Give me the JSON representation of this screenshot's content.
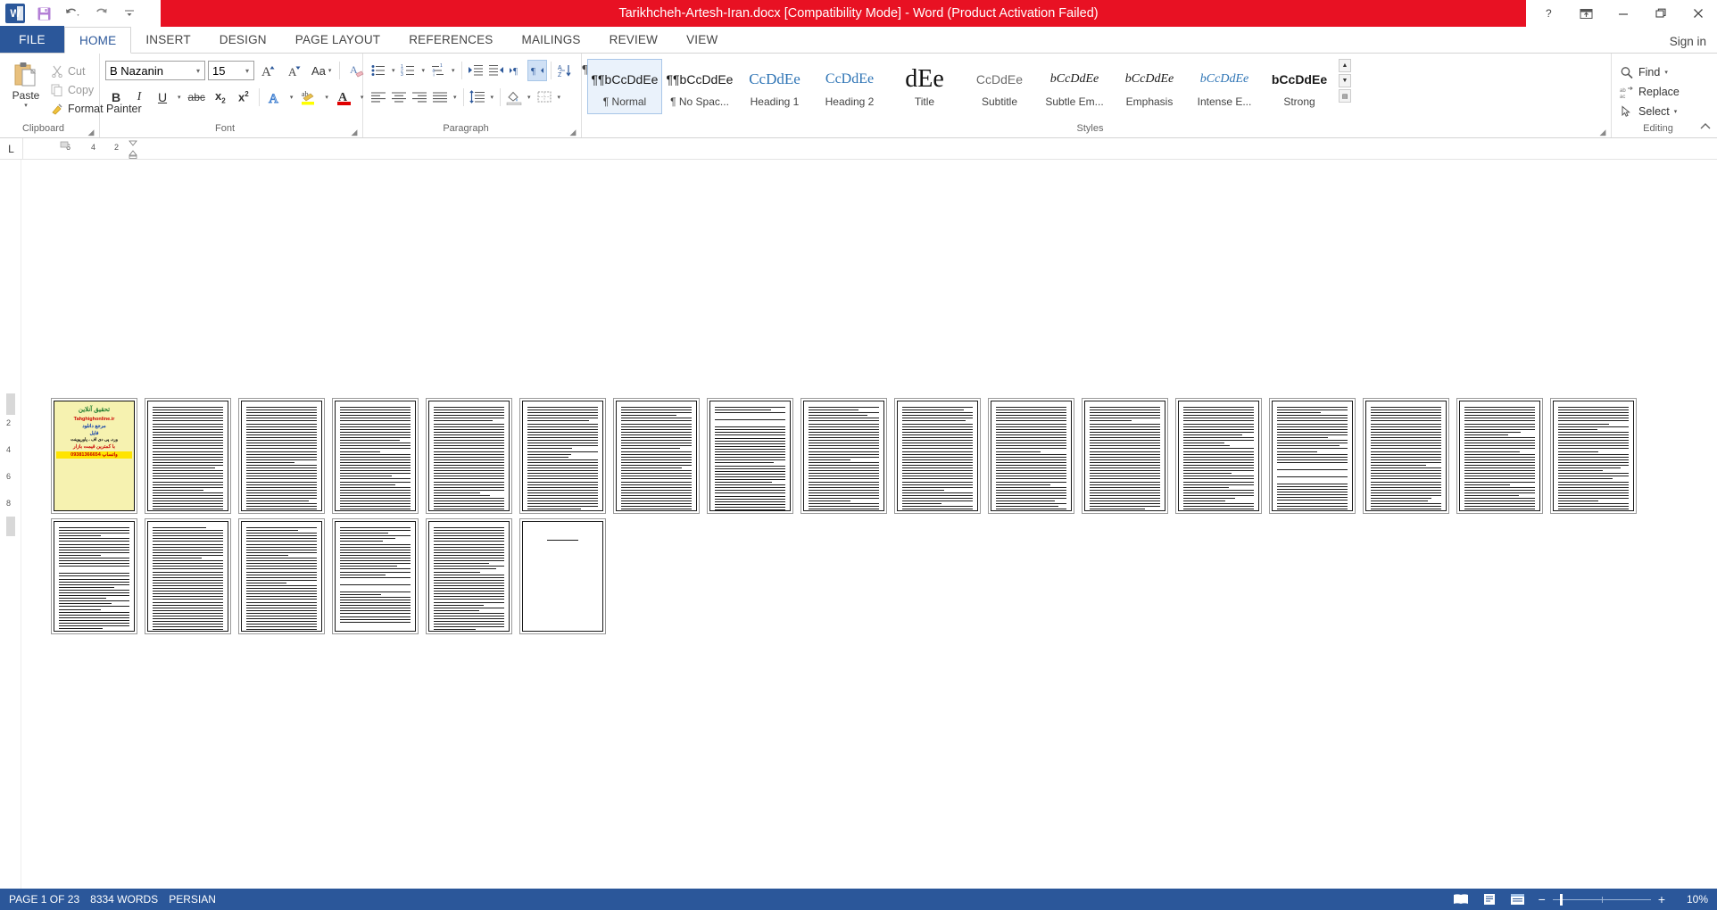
{
  "titlebar": {
    "document_title": "Tarikhcheh-Artesh-Iran.docx [Compatibility Mode]  -  Word (Product Activation Failed)",
    "quick_access": [
      {
        "name": "word-logo",
        "label": "W"
      },
      {
        "name": "save-icon",
        "label": "Save"
      },
      {
        "name": "undo-icon",
        "label": "Undo"
      },
      {
        "name": "redo-icon",
        "label": "Redo"
      },
      {
        "name": "customize-qat-icon",
        "label": "Customize Quick Access Toolbar"
      }
    ],
    "window_buttons": [
      {
        "name": "help-button",
        "glyph": "?"
      },
      {
        "name": "ribbon-display-options-button",
        "glyph": "⬆"
      },
      {
        "name": "minimize-button",
        "glyph": "—"
      },
      {
        "name": "restore-button",
        "glyph": "❐"
      },
      {
        "name": "close-button",
        "glyph": "✕"
      }
    ]
  },
  "tabs": {
    "file_label": "FILE",
    "items": [
      "HOME",
      "INSERT",
      "DESIGN",
      "PAGE LAYOUT",
      "REFERENCES",
      "MAILINGS",
      "REVIEW",
      "VIEW"
    ],
    "active": "HOME",
    "signin_label": "Sign in"
  },
  "ribbon": {
    "clipboard": {
      "group_label": "Clipboard",
      "paste_label": "Paste",
      "cut_label": "Cut",
      "copy_label": "Copy",
      "format_painter_label": "Format Painter"
    },
    "font": {
      "group_label": "Font",
      "font_family_value": "B Nazanin",
      "font_size_value": "15",
      "grow_font_label": "A",
      "shrink_font_label": "A",
      "change_case_label": "Aa",
      "clear_formatting_label": "Clear All Formatting",
      "bold_label": "B",
      "italic_label": "I",
      "underline_label": "U",
      "strikethrough_label": "abc",
      "subscript_label": "x₂",
      "superscript_label": "x²",
      "text_effects_label": "A",
      "highlight_label": "ab",
      "font_color_label": "A"
    },
    "paragraph": {
      "group_label": "Paragraph",
      "bullets_label": "Bullets",
      "numbering_label": "Numbering",
      "multilevel_label": "Multilevel List",
      "decrease_indent_label": "Decrease Indent",
      "increase_indent_label": "Increase Indent",
      "ltr_label": "▸¶",
      "rtl_label": "¶◂",
      "sort_label": "Sort",
      "show_marks_label": "¶",
      "align_left_label": "Align Left",
      "center_label": "Center",
      "align_right_label": "Align Right",
      "justify_label": "Justify",
      "line_spacing_label": "Line and Paragraph Spacing",
      "shading_label": "Shading",
      "borders_label": "Borders",
      "rtl_active": true
    },
    "styles": {
      "group_label": "Styles",
      "items": [
        {
          "name": "Normal",
          "preview": "¶bCcDdEe",
          "prefix": "¶",
          "color": "#1a1a1a",
          "font": "sans",
          "italic": false,
          "bold": false,
          "size": 14,
          "selected": true
        },
        {
          "name": "No Spac...",
          "preview": "¶bCcDdEe",
          "prefix": "¶",
          "color": "#1a1a1a",
          "font": "sans",
          "italic": false,
          "bold": false,
          "size": 14,
          "selected": false
        },
        {
          "name": "Heading 1",
          "preview": "CcDdEe",
          "prefix": "",
          "color": "#2e74b5",
          "font": "serif",
          "italic": false,
          "bold": false,
          "size": 17,
          "selected": false
        },
        {
          "name": "Heading 2",
          "preview": "CcDdEe",
          "prefix": "",
          "color": "#2e74b5",
          "font": "serif",
          "italic": false,
          "bold": false,
          "size": 16,
          "selected": false
        },
        {
          "name": "Title",
          "preview": "dEe",
          "prefix": "",
          "color": "#111111",
          "font": "serif",
          "italic": false,
          "bold": false,
          "size": 28,
          "selected": false
        },
        {
          "name": "Subtitle",
          "preview": "CcDdEe",
          "prefix": "",
          "color": "#6d6d6d",
          "font": "sans",
          "italic": false,
          "bold": false,
          "size": 14,
          "selected": false
        },
        {
          "name": "Subtle Em...",
          "preview": "bCcDdEe",
          "prefix": "",
          "color": "#1a1a1a",
          "font": "serif",
          "italic": true,
          "bold": false,
          "size": 14,
          "selected": false
        },
        {
          "name": "Emphasis",
          "preview": "bCcDdEe",
          "prefix": "",
          "color": "#1a1a1a",
          "font": "serif",
          "italic": true,
          "bold": false,
          "size": 14,
          "selected": false
        },
        {
          "name": "Intense E...",
          "preview": "bCcDdEe",
          "prefix": "",
          "color": "#2e74b5",
          "font": "serif",
          "italic": true,
          "bold": false,
          "size": 14,
          "selected": false
        },
        {
          "name": "Strong",
          "preview": "bCcDdEe",
          "prefix": "",
          "color": "#1a1a1a",
          "font": "sans",
          "italic": false,
          "bold": true,
          "size": 14,
          "selected": false
        }
      ]
    },
    "editing": {
      "group_label": "Editing",
      "find_label": "Find",
      "replace_label": "Replace",
      "select_label": "Select"
    }
  },
  "ruler": {
    "tab_stop_label": "L",
    "h_numbers": [
      "6",
      "4",
      "2"
    ],
    "v_numbers": [
      "2",
      "4",
      "6",
      "8"
    ]
  },
  "document": {
    "page_count": 23,
    "cover": {
      "site_name": "Tahghighonline.ir",
      "line1": "تحقیق آنلاین",
      "line2": "مرجع دانلود",
      "line3": "فایل",
      "line4": "ورد، پی دی اف ، پاورپوینت",
      "line5": "با کمترین قیمت بازار",
      "line6": "09381366654",
      "line7": "واتساپ"
    }
  },
  "statusbar": {
    "page_info": "PAGE 1 OF 23",
    "word_count": "8334 WORDS",
    "language": "PERSIAN",
    "views": [
      {
        "name": "read-mode-button",
        "label": "Read Mode"
      },
      {
        "name": "print-layout-button",
        "label": "Print Layout"
      },
      {
        "name": "web-layout-button",
        "label": "Web Layout"
      }
    ],
    "zoom_out_label": "−",
    "zoom_in_label": "+",
    "zoom_value": "10%"
  },
  "colors": {
    "title_bar": "#e81123",
    "accent": "#2b579a",
    "status_bar": "#2b579a"
  }
}
